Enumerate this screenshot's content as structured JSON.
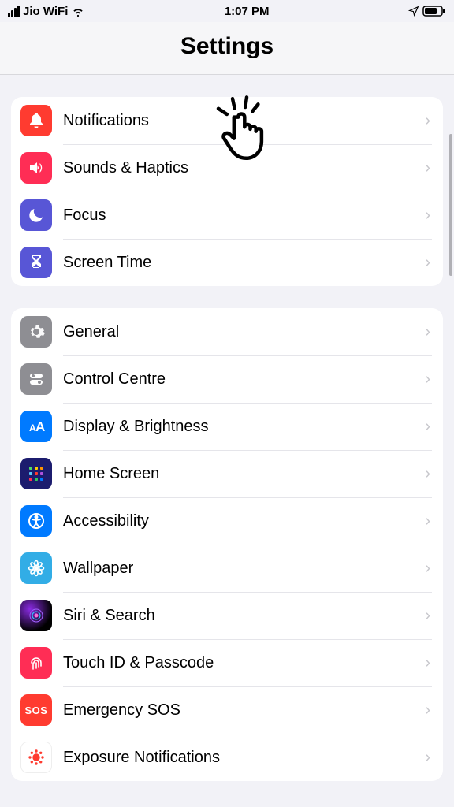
{
  "status": {
    "carrier": "Jio WiFi",
    "time": "1:07 PM"
  },
  "title": "Settings",
  "groups": [
    {
      "rows": [
        {
          "id": "notifications",
          "label": "Notifications"
        },
        {
          "id": "sounds-haptics",
          "label": "Sounds & Haptics"
        },
        {
          "id": "focus",
          "label": "Focus"
        },
        {
          "id": "screen-time",
          "label": "Screen Time"
        }
      ]
    },
    {
      "rows": [
        {
          "id": "general",
          "label": "General"
        },
        {
          "id": "control-centre",
          "label": "Control Centre"
        },
        {
          "id": "display-brightness",
          "label": "Display & Brightness"
        },
        {
          "id": "home-screen",
          "label": "Home Screen"
        },
        {
          "id": "accessibility",
          "label": "Accessibility"
        },
        {
          "id": "wallpaper",
          "label": "Wallpaper"
        },
        {
          "id": "siri-search",
          "label": "Siri & Search"
        },
        {
          "id": "touch-id-passcode",
          "label": "Touch ID & Passcode"
        },
        {
          "id": "emergency-sos",
          "label": "Emergency SOS",
          "badge_text": "SOS"
        },
        {
          "id": "exposure-notifications",
          "label": "Exposure Notifications"
        }
      ]
    }
  ]
}
